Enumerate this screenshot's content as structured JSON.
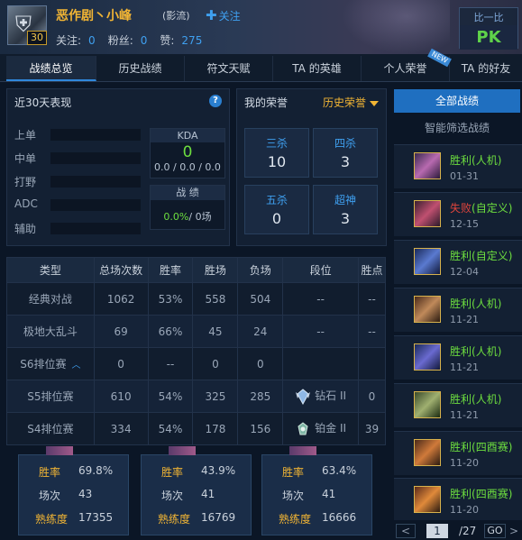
{
  "header": {
    "level": "30",
    "player_name": "恶作剧丶小峰",
    "region": "(影流)",
    "follow_label": "关注",
    "stats": [
      {
        "label": "关注:",
        "value": "0"
      },
      {
        "label": "粉丝:",
        "value": "0"
      },
      {
        "label": "赞:",
        "value": "275"
      }
    ],
    "compare_label": "比一比",
    "pk_label": "PK",
    "colors": {
      "name": "#f2b534",
      "accent": "#3fa0f0",
      "pk": "#5fd24a"
    }
  },
  "tabs": [
    {
      "label": "战绩总览",
      "active": true
    },
    {
      "label": "历史战绩",
      "active": false
    },
    {
      "label": "符文天赋",
      "active": false
    },
    {
      "label": "TA 的英雄",
      "active": false
    },
    {
      "label": "个人荣誉",
      "active": false,
      "badge": "NEW"
    },
    {
      "label": "TA 的好友",
      "active": false
    }
  ],
  "recent": {
    "title": "近30天表现",
    "help_icon": "?",
    "positions": [
      "上单",
      "中单",
      "打野",
      "ADC",
      "辅助"
    ],
    "kda_title": "KDA",
    "kda_value": "0",
    "kda_detail": "0.0 / 0.0 / 0.0",
    "record_title": "战 绩",
    "record_rate": "0.0%",
    "record_games": "/ 0场"
  },
  "honor": {
    "title": "我的荣誉",
    "selector": "历史荣誉",
    "items": [
      {
        "label": "三杀",
        "value": "10"
      },
      {
        "label": "四杀",
        "value": "3"
      },
      {
        "label": "五杀",
        "value": "0"
      },
      {
        "label": "超神",
        "value": "3"
      }
    ]
  },
  "table": {
    "headers": [
      "类型",
      "总场次数",
      "胜率",
      "胜场",
      "负场",
      "段位",
      "胜点"
    ],
    "rows": [
      {
        "type": "经典对战",
        "total": "1062",
        "rate": "53%",
        "wins": "558",
        "losses": "504",
        "tier": "--",
        "points": "--"
      },
      {
        "type": "极地大乱斗",
        "total": "69",
        "rate": "66%",
        "wins": "45",
        "losses": "24",
        "tier": "--",
        "points": "--"
      },
      {
        "type": "S6排位赛",
        "total": "0",
        "rate": "--",
        "wins": "0",
        "losses": "0",
        "tier": "",
        "points": ""
      },
      {
        "type": "S5排位赛",
        "total": "610",
        "rate": "54%",
        "wins": "325",
        "losses": "285",
        "tier": "钻石 II",
        "points": "0"
      },
      {
        "type": "S4排位赛",
        "total": "334",
        "rate": "54%",
        "wins": "178",
        "losses": "156",
        "tier": "铂金 II",
        "points": "39"
      }
    ]
  },
  "champions": [
    {
      "rate_label": "胜率",
      "rate": "69.8%",
      "games_label": "场次",
      "games": "43",
      "mastery_label": "熟练度",
      "mastery": "17355"
    },
    {
      "rate_label": "胜率",
      "rate": "43.9%",
      "games_label": "场次",
      "games": "41",
      "mastery_label": "熟练度",
      "mastery": "16769"
    },
    {
      "rate_label": "胜率",
      "rate": "63.4%",
      "games_label": "场次",
      "games": "41",
      "mastery_label": "熟练度",
      "mastery": "16666"
    }
  ],
  "sidebar": {
    "all_label": "全部战绩",
    "filter_label": "智能筛选战绩",
    "matches": [
      {
        "result": "胜利",
        "mode": "(人机)",
        "date": "01-31",
        "win": true
      },
      {
        "result": "失败",
        "mode": "(自定义)",
        "date": "12-15",
        "win": false
      },
      {
        "result": "胜利",
        "mode": "(自定义)",
        "date": "12-04",
        "win": true
      },
      {
        "result": "胜利",
        "mode": "(人机)",
        "date": "11-21",
        "win": true
      },
      {
        "result": "胜利",
        "mode": "(人机)",
        "date": "11-21",
        "win": true
      },
      {
        "result": "胜利",
        "mode": "(人机)",
        "date": "11-21",
        "win": true
      },
      {
        "result": "胜利",
        "mode": "(四酉赛)",
        "date": "11-20",
        "win": true
      },
      {
        "result": "胜利",
        "mode": "(四酉赛)",
        "date": "11-20",
        "win": true
      }
    ],
    "pager": {
      "prev": "<",
      "page": "1",
      "total": "/27",
      "go": "GO",
      "next": ">"
    }
  }
}
